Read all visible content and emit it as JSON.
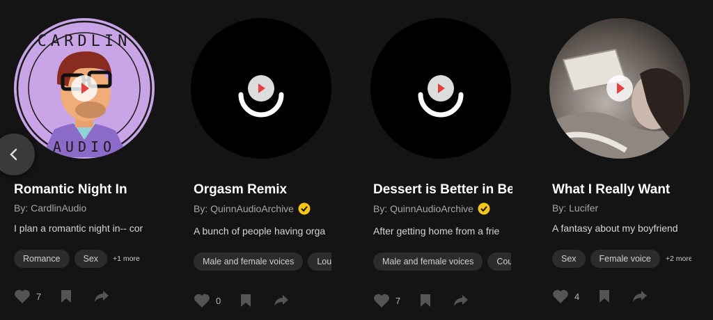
{
  "carousel": {
    "prev_label": "Previous",
    "cards": [
      {
        "title": "Romantic Night In",
        "author": "By: CardlinAudio",
        "verified": false,
        "description": "I plan a romantic night in-- cor",
        "tags": [
          "Romance",
          "Sex"
        ],
        "more": "+1 more",
        "likes": "7",
        "art": "avatar-illustration",
        "art_text_top": "CARDLIN",
        "art_text_bottom": "AUDIO"
      },
      {
        "title": "Orgasm Remix",
        "author": "By: QuinnAudioArchive",
        "verified": true,
        "description": "A bunch of people having orga",
        "tags": [
          "Male and female voices",
          "Lou"
        ],
        "more": "",
        "likes": "0",
        "art": "default-logo"
      },
      {
        "title": "Dessert is Better in Bed",
        "author": "By: QuinnAudioArchive",
        "verified": true,
        "description": "After getting home from a frie",
        "tags": [
          "Male and female voices",
          "Cou"
        ],
        "more": "",
        "likes": "7",
        "art": "default-logo"
      },
      {
        "title": "What I Really Want",
        "author": "By: Lucifer",
        "verified": false,
        "description": "A fantasy about my boyfriend",
        "tags": [
          "Sex",
          "Female voice"
        ],
        "more": "+2 more",
        "likes": "4",
        "art": "photo"
      }
    ]
  },
  "colors": {
    "background": "#141414",
    "tag_bg": "#2c2c2c",
    "verified_badge": "#f5c518",
    "play_triangle": "#e44141",
    "avatar_bg": "#c9a5e8"
  }
}
